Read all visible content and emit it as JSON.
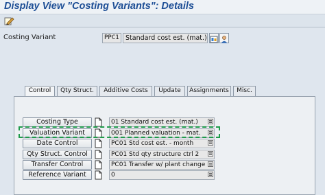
{
  "window": {
    "title": "Display View \"Costing Variants\": Details"
  },
  "toolbar": {
    "items": [
      {
        "icon": "display-change-icon"
      }
    ]
  },
  "header": {
    "costing_variant_label": "Costing Variant",
    "costing_variant_code": "PPC1",
    "costing_variant_desc": "Standard cost est. (mat.)",
    "icons": [
      "display-icon",
      "person-icon"
    ]
  },
  "tabs": [
    {
      "label": "Control",
      "active": true
    },
    {
      "label": "Qty Struct.",
      "active": false
    },
    {
      "label": "Additive Costs",
      "active": false
    },
    {
      "label": "Update",
      "active": false
    },
    {
      "label": "Assignments",
      "active": false
    },
    {
      "label": "Misc.",
      "active": false
    }
  ],
  "fields": [
    {
      "button": "Costing Type",
      "value": "01 Standard cost est. (mat.)"
    },
    {
      "button": "Valuation Variant",
      "value": "001 Planned valuation - mat.",
      "highlighted": true
    },
    {
      "button": "Date Control",
      "value": "PC01 Std cost est. - month"
    },
    {
      "button": "Qty Struct. Control",
      "value": "PC01 Std qty structure ctrl 2"
    },
    {
      "button": "Transfer Control",
      "value": "PC01 Transfer w/ plant change"
    },
    {
      "button": "Reference Variant",
      "value": "0"
    }
  ],
  "colors": {
    "title": "#1e4f96",
    "highlight": "#1f9b4a",
    "background": "#dfe6ee"
  }
}
